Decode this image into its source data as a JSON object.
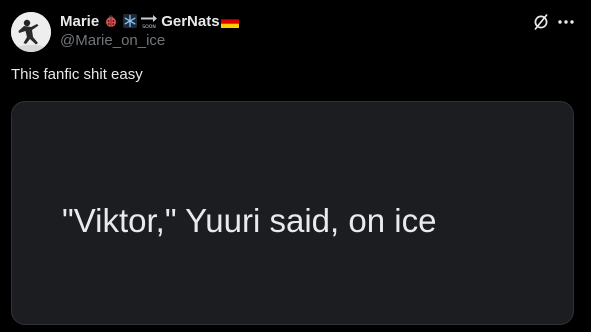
{
  "author": {
    "display_name": "Marie",
    "display_name_2": "GerNats",
    "handle": "@Marie_on_ice",
    "soon_label": "SOON",
    "emojis": [
      "ladybug-icon",
      "snowflake-icon",
      "soon-arrow-icon",
      "germany-flag-icon"
    ]
  },
  "tweet": {
    "text": "This fanfic shit easy"
  },
  "media": {
    "text": "\"Viktor,\" Yuuri said, on ice",
    "background": "#1b1d20"
  },
  "actions": {
    "icons": [
      "slash-circle-icon",
      "more-icon"
    ]
  },
  "colors": {
    "background": "#000000",
    "primary_text": "#e7e9ea",
    "secondary_text": "#71767b",
    "border": "#2f3336"
  }
}
